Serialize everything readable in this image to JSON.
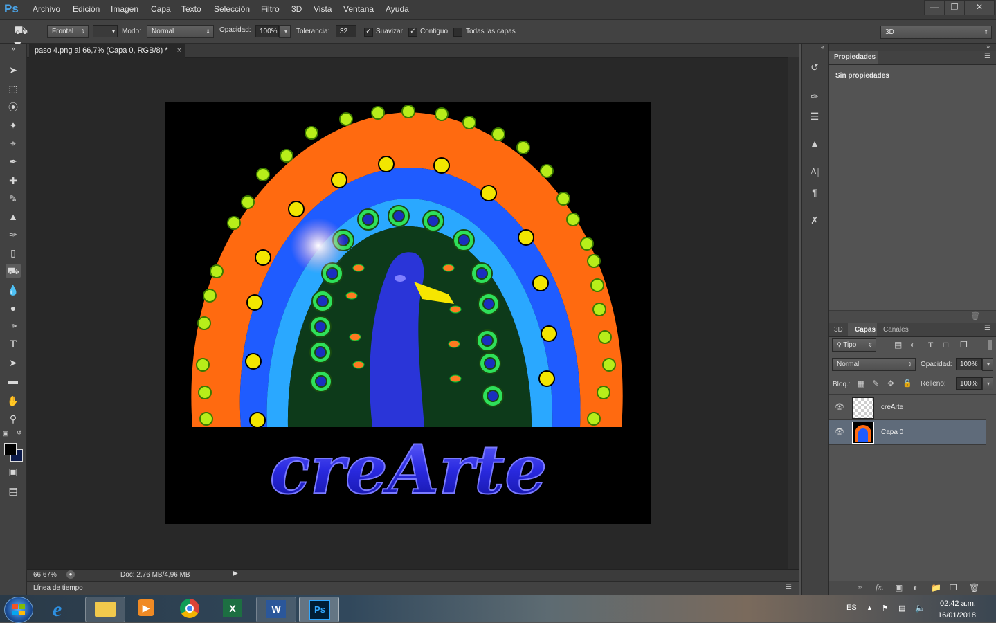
{
  "menubar": {
    "logo": "Ps",
    "items": [
      "Archivo",
      "Edición",
      "Imagen",
      "Capa",
      "Texto",
      "Selección",
      "Filtro",
      "3D",
      "Vista",
      "Ventana",
      "Ayuda"
    ],
    "window_buttons": [
      "minimize",
      "restore",
      "close"
    ]
  },
  "options": {
    "source": "Frontal",
    "mode_label": "Modo:",
    "mode_value": "Normal",
    "opacity_label": "Opacidad:",
    "opacity_value": "100%",
    "tolerance_label": "Tolerancia:",
    "tolerance_value": "32",
    "antialias_label": "Suavizar",
    "contiguous_label": "Contiguo",
    "all_layers_label": "Todas las capas",
    "antialias_checked": true,
    "contiguous_checked": true,
    "all_layers_checked": false,
    "workspace": "3D"
  },
  "document": {
    "tab_title": "paso 4.png al 66,7% (Capa 0, RGB/8) *",
    "canvas_text": "creArte",
    "zoom": "66,67%",
    "doc_info": "Doc: 2,76 MB/4,96 MB",
    "timeline_label": "Línea de tiempo"
  },
  "properties": {
    "tab": "Propiedades",
    "empty_text": "Sin propiedades"
  },
  "layers_panel": {
    "tabs": [
      "3D",
      "Capas",
      "Canales"
    ],
    "active_tab": "Capas",
    "filter_label": "Tipo",
    "blend_mode": "Normal",
    "opacity_label": "Opacidad:",
    "opacity_value": "100%",
    "lock_label": "Bloq.:",
    "fill_label": "Relleno:",
    "fill_value": "100%",
    "layers": [
      {
        "name": "creArte",
        "selected": false
      },
      {
        "name": "Capa 0",
        "selected": true
      }
    ]
  },
  "taskbar": {
    "language": "ES",
    "time": "02:42 a.m.",
    "date": "16/01/2018",
    "apps": [
      "internet-explorer",
      "file-explorer",
      "media-player",
      "chrome",
      "excel",
      "word",
      "photoshop"
    ]
  }
}
